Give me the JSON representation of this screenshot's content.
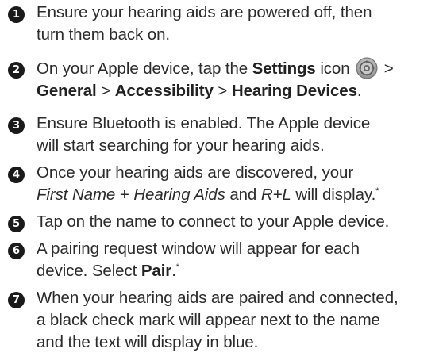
{
  "steps": [
    {
      "number": "1",
      "line1": "Ensure your hearing aids are powered off, then",
      "line2": "turn them back on."
    },
    {
      "number": "2",
      "l1_a": "On your Apple device, tap the ",
      "l1_b": "Settings",
      "l1_c": " icon",
      "l1_d": " >",
      "l2_a": "General",
      "l2_b": " > ",
      "l2_c": "Accessibility",
      "l2_d": " > ",
      "l2_e": "Hearing Devices",
      "l2_f": "."
    },
    {
      "number": "3",
      "line1": "Ensure Bluetooth is enabled. The Apple device",
      "line2": "will start searching for your hearing aids."
    },
    {
      "number": "4",
      "line1": "Once your hearing aids are discovered, your",
      "l2_a": "First Name",
      "l2_b": " + ",
      "l2_c": "Hearing Aids",
      "l2_d": " and ",
      "l2_e": "R+L",
      "l2_f": " will display.",
      "l2_g": "*"
    },
    {
      "number": "5",
      "line1": "Tap on the name to connect to your Apple device."
    },
    {
      "number": "6",
      "line1": "A pairing request window will appear for each",
      "l2_a": "device. Select ",
      "l2_b": "Pair",
      "l2_c": ".",
      "l2_d": "*"
    },
    {
      "number": "7",
      "line1": "When your hearing aids are paired and connected,",
      "line2": "a black check mark will appear next to the name",
      "line3": "and the text will display in blue."
    }
  ],
  "icons": {
    "settings": "settings-gear-icon"
  },
  "colors": {
    "text": "#2b2b2b",
    "badge": "#1a1a1a"
  }
}
